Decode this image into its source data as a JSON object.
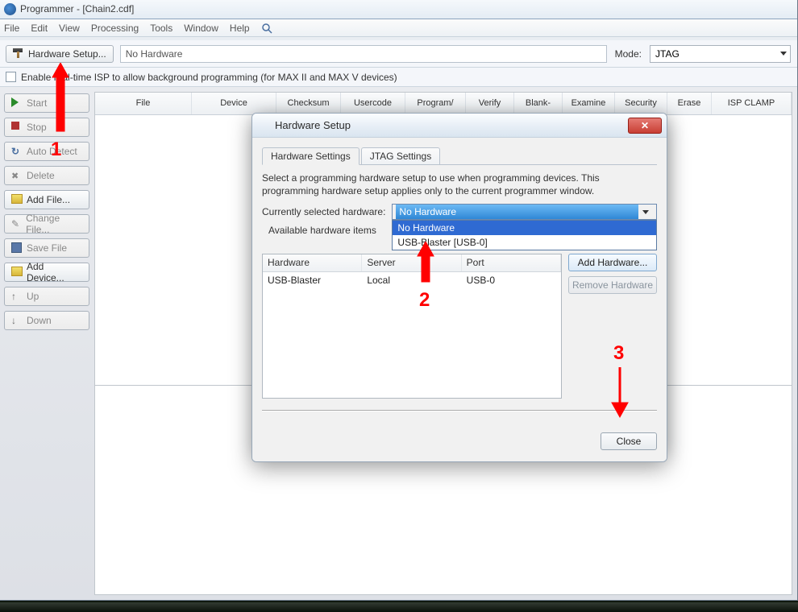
{
  "titlebar": {
    "title": "Programmer - [Chain2.cdf]"
  },
  "menubar": [
    "File",
    "Edit",
    "View",
    "Processing",
    "Tools",
    "Window",
    "Help"
  ],
  "toolbar": {
    "hardware_setup": "Hardware Setup...",
    "hardware_display": "No Hardware",
    "mode_label": "Mode:",
    "mode_value": "JTAG",
    "enable_rtisp": "Enable real-time ISP to allow background programming (for MAX II and MAX V devices)"
  },
  "sidebar": {
    "start": "Start",
    "stop": "Stop",
    "auto_detect": "Auto Detect",
    "delete": "Delete",
    "add_file": "Add File...",
    "change_file": "Change File...",
    "save_file": "Save File",
    "add_device": "Add Device...",
    "up": "Up",
    "down": "Down"
  },
  "grid_columns": [
    "File",
    "Device",
    "Checksum",
    "Usercode",
    "Program/",
    "Verify",
    "Blank-",
    "Examine",
    "Security",
    "Erase",
    "ISP CLAMP"
  ],
  "dialog": {
    "title": "Hardware Setup",
    "tabs": {
      "hw": "Hardware Settings",
      "jtag": "JTAG Settings"
    },
    "description": "Select a programming hardware setup to use when programming devices. This programming hardware setup applies only to the current programmer window.",
    "selected_label": "Currently selected hardware:",
    "selected_value": "No Hardware",
    "dropdown_options": [
      "No Hardware",
      "USB-Blaster [USB-0]"
    ],
    "available_label": "Available hardware items",
    "table_headers": {
      "hardware": "Hardware",
      "server": "Server",
      "port": "Port"
    },
    "table_row": {
      "hardware": "USB-Blaster",
      "server": "Local",
      "port": "USB-0"
    },
    "add_hardware": "Add Hardware...",
    "remove_hardware": "Remove Hardware",
    "close": "Close"
  },
  "annotations": {
    "a1": "1",
    "a2": "2",
    "a3": "3"
  }
}
